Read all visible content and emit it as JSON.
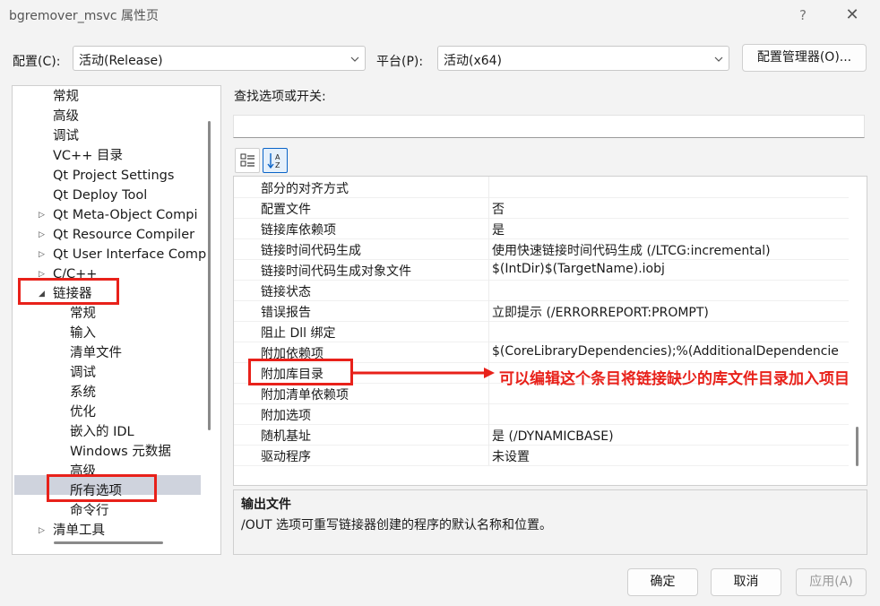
{
  "window": {
    "title": "bgremover_msvc 属性页",
    "help": "?",
    "close": "✕"
  },
  "config": {
    "config_label": "配置(C):",
    "config_value": "活动(Release)",
    "platform_label": "平台(P):",
    "platform_value": "活动(x64)",
    "manager_button": "配置管理器(O)..."
  },
  "tree": {
    "items": [
      {
        "label": "常规",
        "level": 1
      },
      {
        "label": "高级",
        "level": 1
      },
      {
        "label": "调试",
        "level": 1
      },
      {
        "label": "VC++ 目录",
        "level": 1
      },
      {
        "label": "Qt Project Settings",
        "level": 1
      },
      {
        "label": "Qt Deploy Tool",
        "level": 1
      },
      {
        "label": "Qt Meta-Object Compi",
        "level": 1,
        "arrow": "▷"
      },
      {
        "label": "Qt Resource Compiler",
        "level": 1,
        "arrow": "▷"
      },
      {
        "label": "Qt User Interface Comp",
        "level": 1,
        "arrow": "▷"
      },
      {
        "label": "C/C++",
        "level": 1,
        "arrow": "▷"
      },
      {
        "label": "链接器",
        "level": 1,
        "arrow": "◢"
      },
      {
        "label": "常规",
        "level": 2
      },
      {
        "label": "输入",
        "level": 2
      },
      {
        "label": "清单文件",
        "level": 2
      },
      {
        "label": "调试",
        "level": 2
      },
      {
        "label": "系统",
        "level": 2
      },
      {
        "label": "优化",
        "level": 2
      },
      {
        "label": "嵌入的 IDL",
        "level": 2
      },
      {
        "label": "Windows 元数据",
        "level": 2
      },
      {
        "label": "高级",
        "level": 2
      },
      {
        "label": "所有选项",
        "level": 2,
        "selected": true
      },
      {
        "label": "命令行",
        "level": 2
      },
      {
        "label": "清单工具",
        "level": 1,
        "arrow": "▷"
      }
    ]
  },
  "search": {
    "label": "查找选项或开关:",
    "value": ""
  },
  "properties": {
    "rows": [
      {
        "name": "部分的对齐方式",
        "value": ""
      },
      {
        "name": "配置文件",
        "value": "否"
      },
      {
        "name": "链接库依赖项",
        "value": "是"
      },
      {
        "name": "链接时间代码生成",
        "value": "使用快速链接时间代码生成 (/LTCG:incremental)"
      },
      {
        "name": "链接时间代码生成对象文件",
        "value": "$(IntDir)$(TargetName).iobj"
      },
      {
        "name": "链接状态",
        "value": ""
      },
      {
        "name": "错误报告",
        "value": "立即提示 (/ERRORREPORT:PROMPT)"
      },
      {
        "name": "阻止 Dll 绑定",
        "value": ""
      },
      {
        "name": "附加依赖项",
        "value": "$(CoreLibraryDependencies);%(AdditionalDependencie"
      },
      {
        "name": "附加库目录",
        "value": ""
      },
      {
        "name": "附加清单依赖项",
        "value": ""
      },
      {
        "name": "附加选项",
        "value": ""
      },
      {
        "name": "随机基址",
        "value": "是 (/DYNAMICBASE)"
      },
      {
        "name": "驱动程序",
        "value": "未设置"
      }
    ]
  },
  "description": {
    "title": "输出文件",
    "text": "/OUT 选项可重写链接器创建的程序的默认名称和位置。"
  },
  "buttons": {
    "ok": "确定",
    "cancel": "取消",
    "apply": "应用(A)"
  },
  "annotation": {
    "text": "可以编辑这个条目将链接缺少的库文件目录加入项目"
  },
  "colors": {
    "annotation_red": "#e8211a",
    "selected_bg": "#cfd3dd",
    "toolbar_active_border": "#0a64c8"
  }
}
